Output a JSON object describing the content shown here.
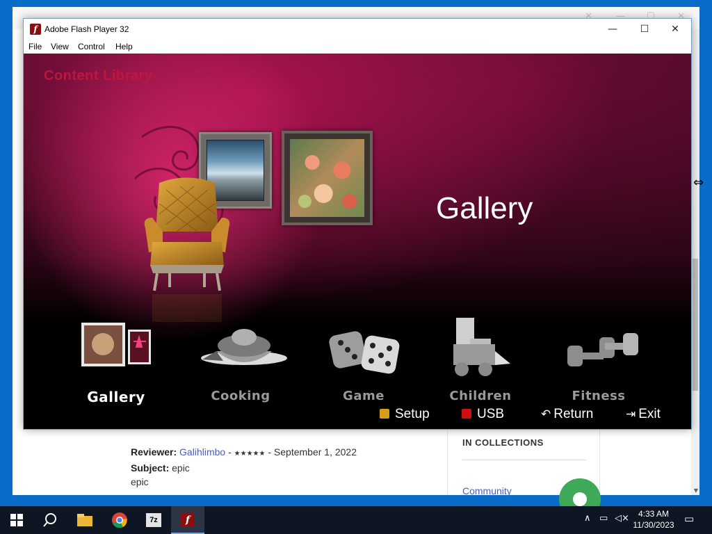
{
  "window": {
    "title": "Adobe Flash Player 32",
    "controls": {
      "minimize": "—",
      "maximize": "☐",
      "close": "✕"
    }
  },
  "menu": [
    "File",
    "View",
    "Control",
    "Help"
  ],
  "stage": {
    "header": "Content Library",
    "section_title": "Gallery",
    "categories": [
      {
        "label": "Gallery",
        "selected": true
      },
      {
        "label": "Cooking",
        "selected": false
      },
      {
        "label": "Game",
        "selected": false
      },
      {
        "label": "Children",
        "selected": false
      },
      {
        "label": "Fitness",
        "selected": false
      }
    ],
    "controls": [
      {
        "label": "Setup",
        "color": "#d4a017"
      },
      {
        "label": "USB",
        "color": "#d01010"
      },
      {
        "label": "Return",
        "icon": "return-icon"
      },
      {
        "label": "Exit",
        "icon": "exit-icon"
      }
    ]
  },
  "background_page": {
    "review": {
      "reviewer_label": "Reviewer:",
      "reviewer": "Galihlimbo",
      "sep1": "-",
      "stars": "★★★★★",
      "sep2": "-",
      "date": "September 1, 2022",
      "subject_label": "Subject:",
      "subject": "epic",
      "body": "epic"
    },
    "collections": {
      "title": "IN COLLECTIONS",
      "link": "Community"
    }
  },
  "taskbar": {
    "time": "4:33 AM",
    "date": "11/30/2023",
    "apps": [
      "windows-start-icon",
      "search-icon",
      "file-explorer-icon",
      "chrome-icon",
      "7zip-icon",
      "flash-player-icon"
    ],
    "sevenzip_label": "7z"
  },
  "colors": {
    "stage_magenta": "#b01452",
    "header_red": "#c2183f",
    "taskbar": "#0e1624",
    "desktop": "#0a6cc9"
  }
}
